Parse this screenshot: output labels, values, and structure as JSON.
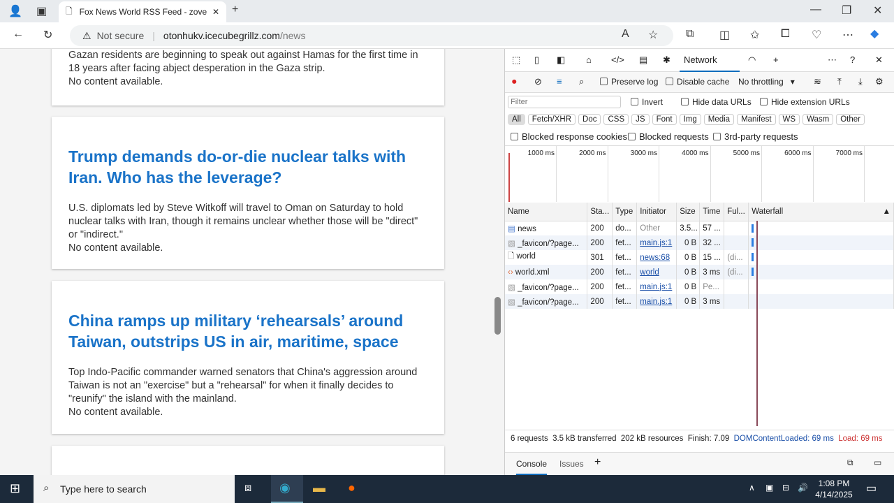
{
  "browser": {
    "tab_title": "Fox News World RSS Feed - zove",
    "not_secure": "Not secure",
    "url_host": "otonhukv.icecubegrillz.com",
    "url_path": "/news"
  },
  "articles": [
    {
      "title": "",
      "desc": "Gazan residents are beginning to speak out against Hamas for the first time in 18 years after facing abject desperation in the Gaza strip.",
      "note": "No content available."
    },
    {
      "title": "Trump demands do-or-die nuclear talks with Iran. Who has the leverage?",
      "desc": "U.S. diplomats led by Steve Witkoff will travel to Oman on Saturday to hold nuclear talks with Iran, though it remains unclear whether those will be \"direct\" or \"indirect.\"",
      "note": "No content available."
    },
    {
      "title": "China ramps up military ‘rehearsals’ around Taiwan, outstrips US in air, maritime, space",
      "desc": "Top Indo-Pacific commander warned senators that China's aggression around Taiwan is not an \"exercise\" but a \"rehearsal\" for when it finally decides to \"reunify\" the island with the mainland.",
      "note": "No content available."
    }
  ],
  "devtools": {
    "tab": "Network",
    "preserve_log": "Preserve log",
    "disable_cache": "Disable cache",
    "throttling": "No throttling",
    "filter_placeholder": "Filter",
    "invert": "Invert",
    "hide_data": "Hide data URLs",
    "hide_ext": "Hide extension URLs",
    "chips": [
      "All",
      "Fetch/XHR",
      "Doc",
      "CSS",
      "JS",
      "Font",
      "Img",
      "Media",
      "Manifest",
      "WS",
      "Wasm",
      "Other"
    ],
    "blocked_cookies": "Blocked response cookies",
    "blocked_req": "Blocked requests",
    "third_party": "3rd-party requests",
    "ticks": [
      "1000 ms",
      "2000 ms",
      "3000 ms",
      "4000 ms",
      "5000 ms",
      "6000 ms",
      "7000 ms"
    ],
    "columns": [
      "Name",
      "Sta...",
      "Type",
      "Initiator",
      "Size",
      "Time",
      "Ful...",
      "Waterfall"
    ],
    "rows": [
      [
        "news",
        "200",
        "do...",
        "Other",
        "3.5...",
        "57 ...",
        ""
      ],
      [
        "_favicon/?page...",
        "200",
        "fet...",
        "main.js:1",
        "0 B",
        "32 ...",
        ""
      ],
      [
        "world",
        "301",
        "fet...",
        "news:68",
        "0 B",
        "15 ...",
        "(di..."
      ],
      [
        "world.xml",
        "200",
        "fet...",
        "world",
        "0 B",
        "3 ms",
        "(di..."
      ],
      [
        "_favicon/?page...",
        "200",
        "fet...",
        "main.js:1",
        "0 B",
        "Pe...",
        ""
      ],
      [
        "_favicon/?page...",
        "200",
        "fet...",
        "main.js:1",
        "0 B",
        "3 ms",
        ""
      ]
    ],
    "summary": {
      "requests": "6 requests",
      "transferred": "3.5 kB transferred",
      "resources": "202 kB resources",
      "finish": "Finish: 7.09",
      "dcl": "DOMContentLoaded: 69 ms",
      "load": "Load: 69 ms"
    },
    "drawer": {
      "console": "Console",
      "issues": "Issues"
    }
  },
  "taskbar": {
    "search": "Type here to search",
    "time": "1:08 PM",
    "date": "4/14/2025"
  }
}
